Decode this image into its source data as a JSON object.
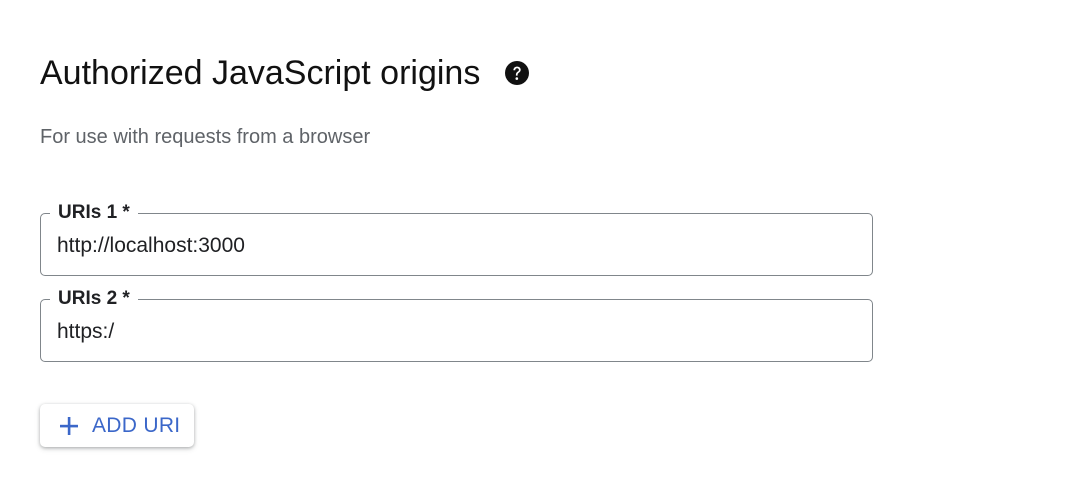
{
  "section": {
    "title": "Authorized JavaScript origins",
    "help_icon": "help-circle-icon",
    "subtitle": "For use with requests from a browser"
  },
  "uris": [
    {
      "label": "URIs 1 *",
      "value": "http://localhost:3000"
    },
    {
      "label": "URIs 2 *",
      "value": "https:/"
    }
  ],
  "add_button": {
    "icon": "plus-icon",
    "label": "ADD URI"
  },
  "colors": {
    "accent": "#3b67c9",
    "border": "#80868b",
    "secondary_text": "#5f6368"
  }
}
